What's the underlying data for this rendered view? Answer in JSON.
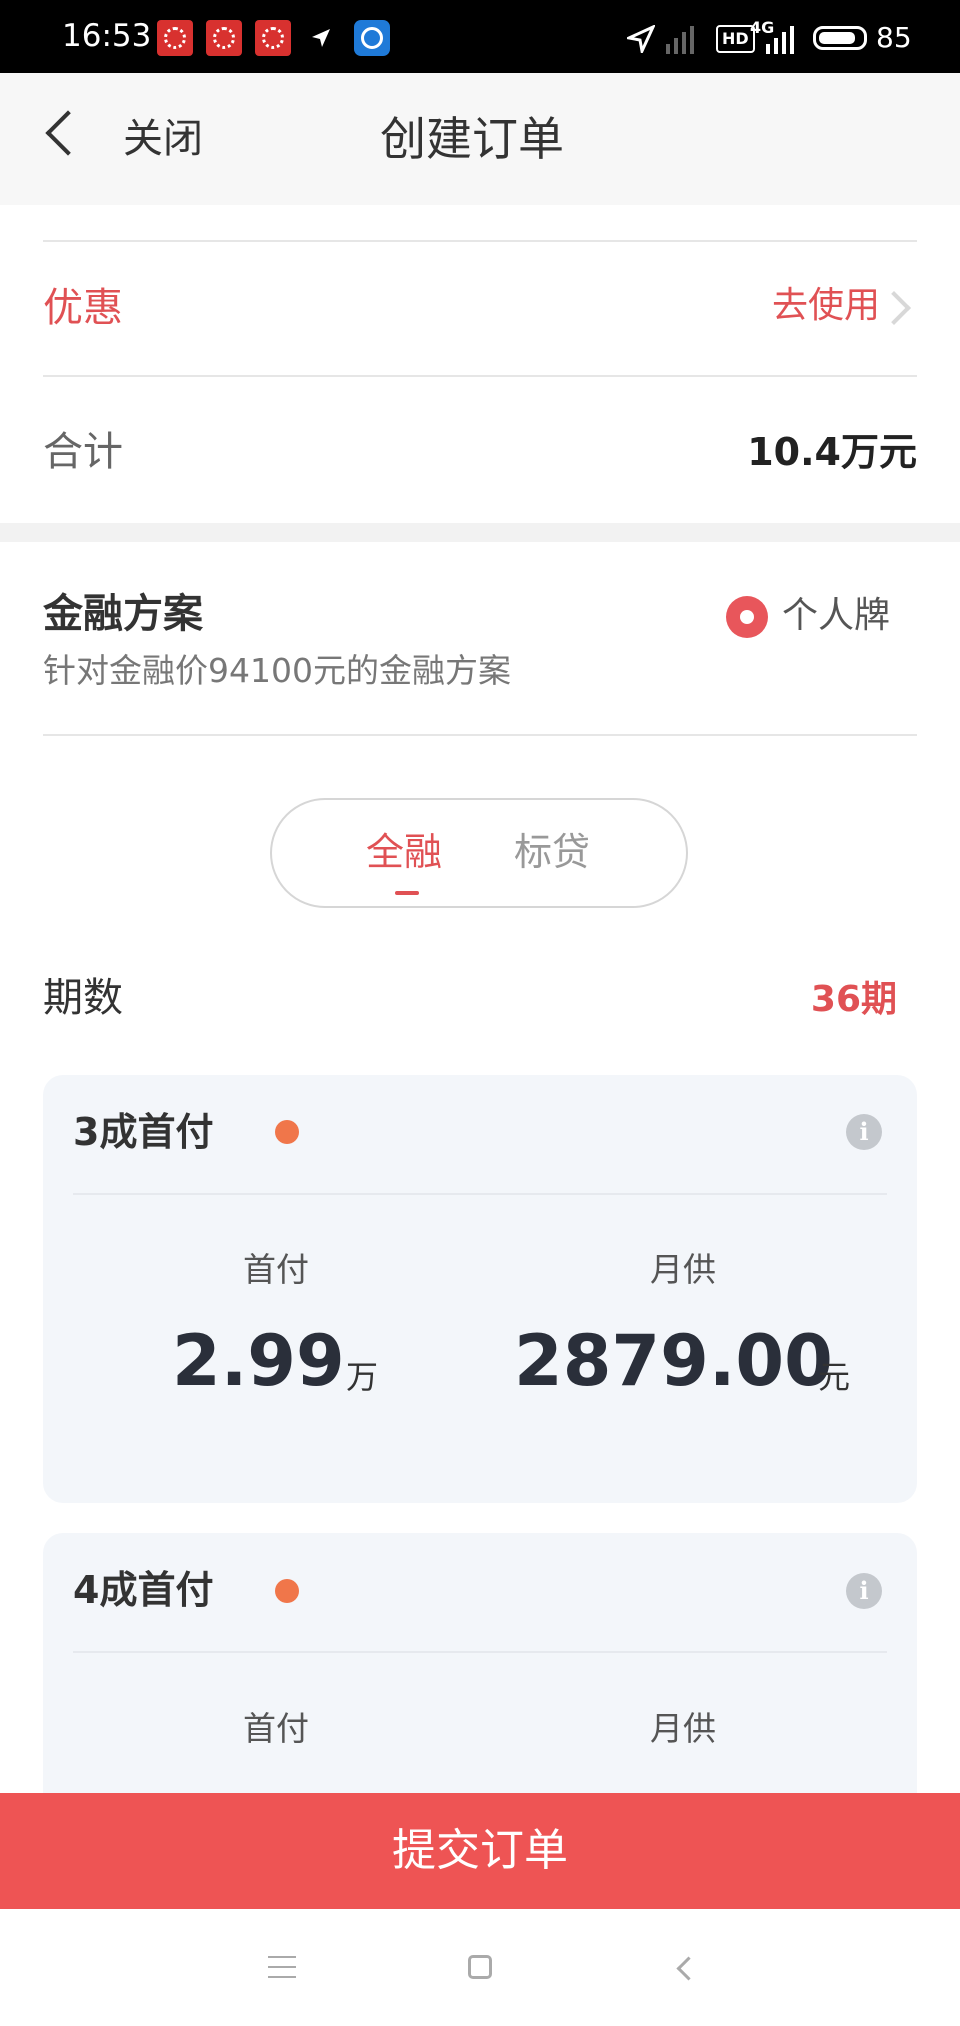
{
  "status_bar": {
    "time": "16:53",
    "network": "4G",
    "hd": "HD",
    "battery_percent": "85",
    "battery_level": 0.85,
    "icons": [
      "notification-icon",
      "notification-icon",
      "notification-icon",
      "location-icon",
      "app-icon",
      "location-arrow-icon",
      "signal-icon",
      "hd-icon",
      "battery-icon"
    ]
  },
  "header": {
    "back_icon": "chevron-left-icon",
    "close_label": "关闭",
    "title": "创建订单"
  },
  "promo": {
    "label": "优惠",
    "action_label": "去使用",
    "action_icon": "chevron-right-icon"
  },
  "total": {
    "label": "合计",
    "value": "10.4万元"
  },
  "finance": {
    "title": "金融方案",
    "subtitle": "针对金融价94100元的金融方案",
    "plate_option": "个人牌",
    "tabs": [
      {
        "label": "全融",
        "active": true
      },
      {
        "label": "标贷",
        "active": false
      }
    ],
    "term_label": "期数",
    "term_value": "36期"
  },
  "cards": [
    {
      "title": "3成首付",
      "down_label": "首付",
      "down_value": "2.99",
      "down_unit": "万",
      "monthly_label": "月供",
      "monthly_value": "2879.00",
      "monthly_unit": "元"
    },
    {
      "title": "4成首付",
      "down_label": "首付",
      "monthly_label": "月供"
    }
  ],
  "submit_label": "提交订单",
  "nav": [
    "menu-icon",
    "home-icon",
    "back-icon"
  ],
  "colors": {
    "accent": "#e05154",
    "submit": "#ee5454",
    "dot": "#f0764a",
    "card_bg": "#f3f6fa"
  }
}
